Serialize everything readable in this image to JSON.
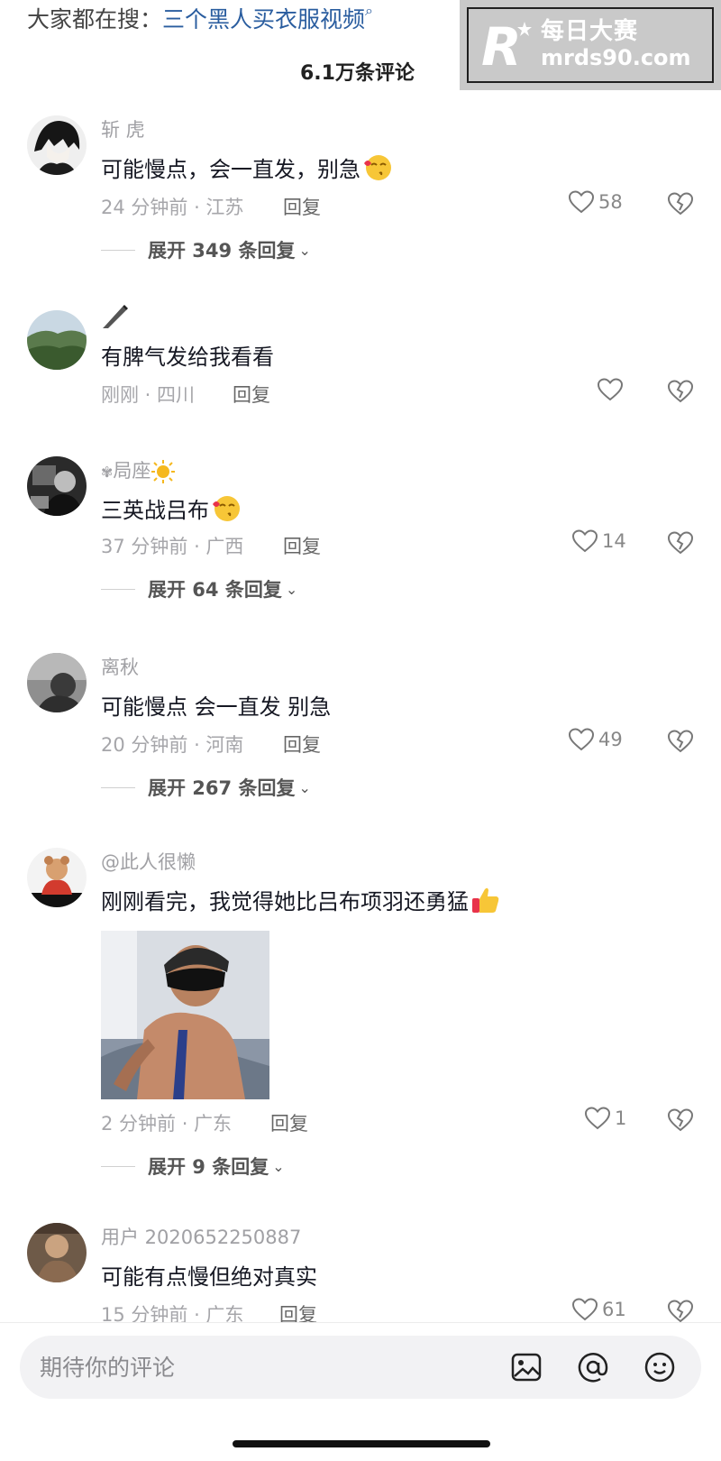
{
  "search_bar": {
    "prefix": "大家都在搜：",
    "term": "三个黑人买衣服视频"
  },
  "comment_count": "6.1万条评论",
  "watermark": {
    "title": "每日大赛",
    "url": "mrds90.com"
  },
  "comments": [
    {
      "username": "斩 虎",
      "text": "可能慢点，会一直发，别急",
      "emoji": "kiss-face",
      "meta": "24 分钟前 · 江苏",
      "reply": "回复",
      "likes": "58",
      "expand": "展开 349 条回复"
    },
    {
      "username": "",
      "username_icon": "pen-icon",
      "text": "有脾气发给我看看",
      "meta": "刚刚 · 四川",
      "reply": "回复",
      "likes": ""
    },
    {
      "username": "局座",
      "username_icon": "sun-icon",
      "text": "三英战吕布",
      "emoji": "kiss-face",
      "meta": "37 分钟前 · 广西",
      "reply": "回复",
      "likes": "14",
      "expand": "展开 64 条回复"
    },
    {
      "username": "离秋",
      "text": "可能慢点 会一直发 别急",
      "meta": "20 分钟前 · 河南",
      "reply": "回复",
      "likes": "49",
      "expand": "展开 267 条回复"
    },
    {
      "username": "@此人很懒",
      "text": "刚刚看完，我觉得她比吕布项羽还勇猛",
      "emoji": "thumbs-up",
      "meta": "2 分钟前 · 广东",
      "reply": "回复",
      "likes": "1",
      "expand": "展开 9 条回复"
    },
    {
      "username": "用户 2020652250887",
      "text": "可能有点慢但绝对真实",
      "meta": "15 分钟前 · 广东",
      "reply": "回复",
      "likes": "61"
    }
  ],
  "composer": {
    "placeholder": "期待你的评论"
  },
  "icons": {
    "like": "heart-icon",
    "dislike": "broken-heart-icon",
    "image": "image-icon",
    "mention": "at-icon",
    "emoji": "emoji-icon"
  },
  "colors": {
    "search_term": "#2a5d9f",
    "text": "#161823",
    "meta": "#a6a6aa"
  }
}
